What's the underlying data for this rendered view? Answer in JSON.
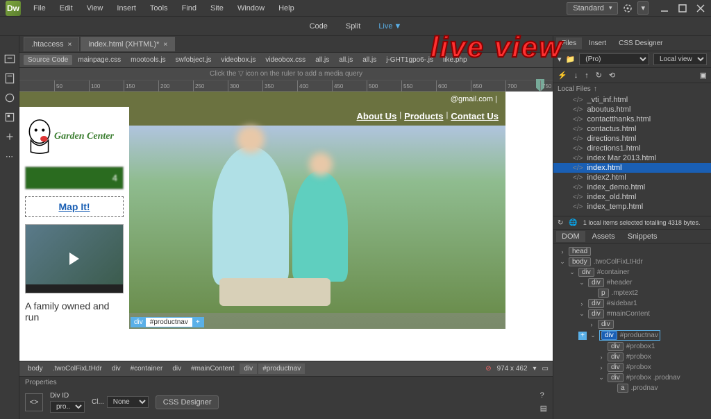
{
  "app": {
    "logo": "Dw"
  },
  "menu": [
    "File",
    "Edit",
    "View",
    "Insert",
    "Tools",
    "Find",
    "Site",
    "Window",
    "Help"
  ],
  "workspace": {
    "label": "Standard"
  },
  "viewToggle": {
    "code": "Code",
    "split": "Split",
    "live": "Live",
    "active": "live"
  },
  "documentTabs": [
    {
      "label": ".htaccess",
      "active": false
    },
    {
      "label": "index.html (XHTML)*",
      "active": true
    }
  ],
  "relatedFiles": [
    "Source Code",
    "mainpage.css",
    "mootools.js",
    "swfobject.js",
    "videobox.js",
    "videobox.css",
    "all.js",
    "all.js",
    "all.js",
    "j-GHT1gpo6-.js",
    "like.php"
  ],
  "relatedActive": 0,
  "mediaQueryHint": "Click the ▽ icon on the ruler to add a media query",
  "rulerTicks": [
    50,
    100,
    150,
    200,
    250,
    300,
    350,
    400,
    450,
    500,
    550,
    600,
    650,
    700,
    750
  ],
  "livePage": {
    "email": "@gmail.com | ",
    "logoText": "Garden Center",
    "phone": "4",
    "mapLink": "Map It!",
    "family": "A family owned and run",
    "nav": [
      "About Us",
      "Products",
      "Contact Us"
    ],
    "selector": {
      "tag": "div",
      "id": "#productnav",
      "plus": "+"
    }
  },
  "tagSelector": [
    {
      "text": "body",
      "sel": false
    },
    {
      "text": ".twoColFixLtHdr",
      "sel": false
    },
    {
      "text": "div",
      "sel": false
    },
    {
      "text": "#container",
      "sel": false
    },
    {
      "text": "div",
      "sel": false
    },
    {
      "text": "#mainContent",
      "sel": false
    },
    {
      "text": "div",
      "sel": true
    },
    {
      "text": "#productnav",
      "sel": true
    }
  ],
  "viewportSize": "974 x 462",
  "properties": {
    "title": "Properties",
    "divIdLabel": "Div ID",
    "divIdValue": "pro...",
    "classLabel": "Cl...",
    "classValue": "None",
    "cssDesigner": "CSS Designer"
  },
  "rightPanel": {
    "tabs": [
      "Files",
      "Insert",
      "CSS Designer"
    ],
    "tabActive": 0,
    "siteSelector": "(Pro)",
    "viewSelector": "Local view",
    "localFilesLabel": "Local Files",
    "files": [
      {
        "name": "_vti_inf.html",
        "sel": false
      },
      {
        "name": "aboutus.html",
        "sel": false
      },
      {
        "name": "contactthanks.html",
        "sel": false
      },
      {
        "name": "contactus.html",
        "sel": false
      },
      {
        "name": "directions.html",
        "sel": false
      },
      {
        "name": "directions1.html",
        "sel": false
      },
      {
        "name": "index Mar 2013.html",
        "sel": false
      },
      {
        "name": "index.html",
        "sel": true
      },
      {
        "name": "index2.html",
        "sel": false
      },
      {
        "name": "index_demo.html",
        "sel": false
      },
      {
        "name": "index_old.html",
        "sel": false
      },
      {
        "name": "index_temp.html",
        "sel": false
      }
    ],
    "statusText": "1 local items selected totalling 4318 bytes.",
    "domTabs": [
      "DOM",
      "Assets",
      "Snippets"
    ],
    "domTabActive": 0,
    "domTree": [
      {
        "indent": 0,
        "caret": "›",
        "tag": "head",
        "cls": ""
      },
      {
        "indent": 0,
        "caret": "⌄",
        "tag": "body",
        "cls": ".twoColFixLtHdr"
      },
      {
        "indent": 1,
        "caret": "⌄",
        "tag": "div",
        "cls": "#container"
      },
      {
        "indent": 2,
        "caret": "⌄",
        "tag": "div",
        "cls": "#header"
      },
      {
        "indent": 3,
        "caret": "",
        "tag": "p",
        "cls": ".mptext2"
      },
      {
        "indent": 2,
        "caret": "›",
        "tag": "div",
        "cls": "#sidebar1"
      },
      {
        "indent": 2,
        "caret": "⌄",
        "tag": "div",
        "cls": "#mainContent"
      },
      {
        "indent": 3,
        "caret": "›",
        "tag": "div",
        "cls": ""
      },
      {
        "indent": 3,
        "caret": "⌄",
        "tag": "div",
        "cls": "#productnav",
        "sel": true,
        "plus": true
      },
      {
        "indent": 4,
        "caret": "",
        "tag": "div",
        "cls": "#probox1"
      },
      {
        "indent": 4,
        "caret": "›",
        "tag": "div",
        "cls": "#probox"
      },
      {
        "indent": 4,
        "caret": "›",
        "tag": "div",
        "cls": "#probox"
      },
      {
        "indent": 4,
        "caret": "⌄",
        "tag": "div",
        "cls": "#probox .prodnav"
      },
      {
        "indent": 5,
        "caret": "",
        "tag": "a",
        "cls": ".prodnav"
      }
    ]
  },
  "annotation": "Live view"
}
